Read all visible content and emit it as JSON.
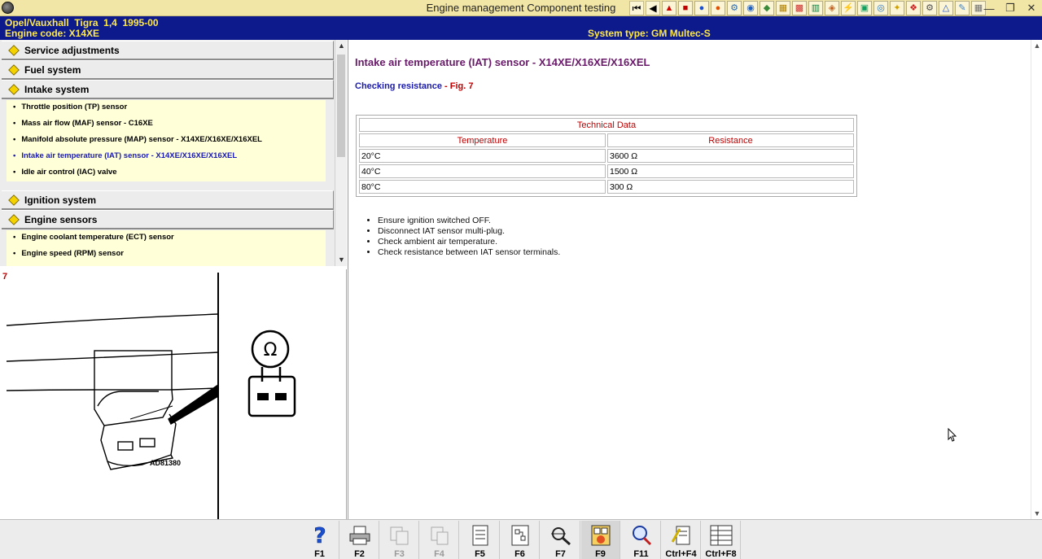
{
  "window": {
    "title": "Engine management Component testing"
  },
  "vehicle": {
    "line1": "Opel/Vauxhall  Tigra  1,4  1995-00",
    "line2": "Engine code: X14XE",
    "system_type": "System type: GM Multec-S"
  },
  "tree": {
    "sections": [
      {
        "label": "Service adjustments",
        "open": false
      },
      {
        "label": "Fuel system",
        "open": false
      },
      {
        "label": "Intake system",
        "open": true,
        "items": [
          "Throttle position (TP) sensor",
          "Mass air flow (MAF) sensor - C16XE",
          "Manifold absolute pressure (MAP) sensor - X14XE/X16XE/X16XEL",
          "Intake air temperature (IAT) sensor - X14XE/X16XE/X16XEL",
          "Idle air control (IAC) valve"
        ],
        "active_item": "Intake air temperature (IAT) sensor - X14XE/X16XE/X16XEL"
      },
      {
        "label": "Ignition system",
        "open": false
      },
      {
        "label": "Engine sensors",
        "open": true,
        "items": [
          "Engine coolant temperature (ECT) sensor",
          "Engine speed (RPM) sensor"
        ]
      }
    ]
  },
  "figure": {
    "number": "7",
    "code": "AD81380",
    "symbol": "Ω"
  },
  "content": {
    "title": "Intake air temperature (IAT) sensor - X14XE/X16XE/X16XEL",
    "subheading": "Checking resistance",
    "subheading_sep": " - ",
    "fig_ref": "Fig. 7",
    "table": {
      "caption": "Technical Data",
      "headers": [
        "Temperature",
        "Resistance"
      ],
      "rows": [
        [
          "20°C",
          "3600 Ω"
        ],
        [
          "40°C",
          "1500 Ω"
        ],
        [
          "80°C",
          "300 Ω"
        ]
      ]
    },
    "steps": [
      "Ensure ignition switched OFF.",
      "Disconnect IAT sensor multi-plug.",
      "Check ambient air temperature.",
      "Check resistance between IAT sensor terminals."
    ]
  },
  "function_keys": [
    {
      "label": "F1",
      "icon": "help-icon",
      "enabled": true
    },
    {
      "label": "F2",
      "icon": "print-icon",
      "enabled": true
    },
    {
      "label": "F3",
      "icon": "copy-icon",
      "enabled": false
    },
    {
      "label": "F4",
      "icon": "paste-icon",
      "enabled": false
    },
    {
      "label": "F5",
      "icon": "document-icon",
      "enabled": true
    },
    {
      "label": "F6",
      "icon": "wiring-icon",
      "enabled": true
    },
    {
      "label": "F7",
      "icon": "magnify-icon",
      "enabled": true
    },
    {
      "label": "F9",
      "icon": "number-icon",
      "enabled": true,
      "pressed": true
    },
    {
      "label": "F11",
      "icon": "search-icon",
      "enabled": true
    },
    {
      "label": "Ctrl+F4",
      "icon": "notes-icon",
      "enabled": true
    },
    {
      "label": "Ctrl+F8",
      "icon": "list-icon",
      "enabled": true
    }
  ],
  "colors": {
    "title_bar": "#f2e6a6",
    "vehicle_bar": "#0c1a8c",
    "vehicle_text": "#ffe84a",
    "item_bg": "#ffffd8",
    "accent_red": "#c00000",
    "link_blue": "#1a1ab0",
    "title_purple": "#6a1a6a"
  }
}
